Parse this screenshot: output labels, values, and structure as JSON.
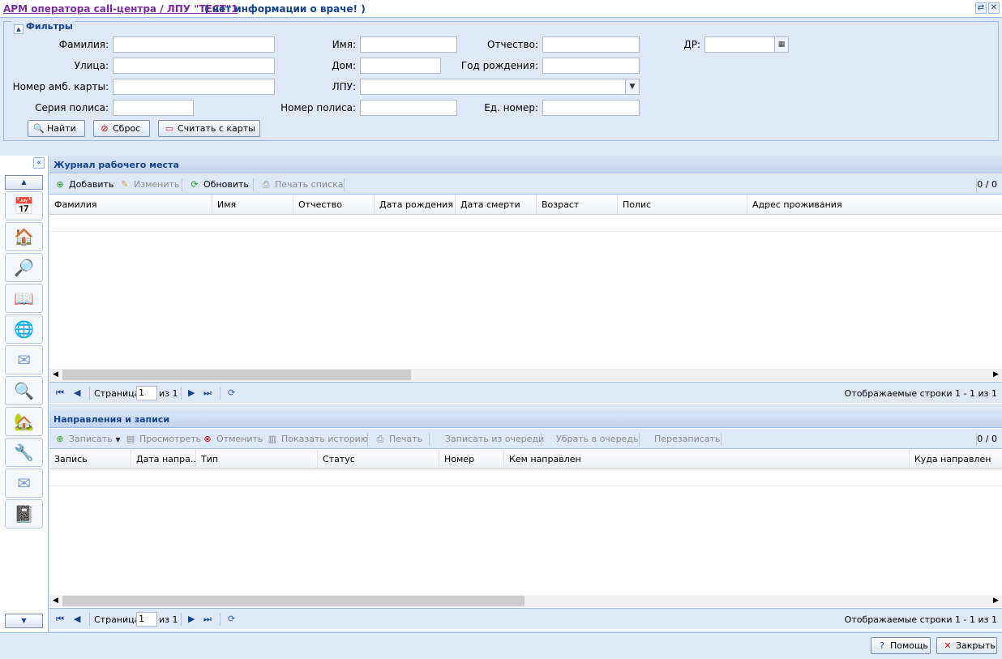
{
  "window": {
    "title": "АРМ оператора call-центра / ЛПУ \"ТЕСТ\"1",
    "subtitle": "( нет информации о враче! )"
  },
  "filters": {
    "legend": "Фильтры",
    "labels": {
      "surname": "Фамилия:",
      "name": "Имя:",
      "patronymic": "Отчество:",
      "dob": "ДР:",
      "street": "Улица:",
      "house": "Дом:",
      "birth_year": "Год рождения:",
      "card_number": "Номер амб. карты:",
      "lpu": "ЛПУ:",
      "policy_series": "Серия полиса:",
      "policy_number": "Номер полиса:",
      "unified_number": "Ед. номер:"
    },
    "buttons": {
      "find": "Найти",
      "reset": "Сброс",
      "read_card": "Считать с карты"
    }
  },
  "journal": {
    "title": "Журнал рабочего места",
    "toolbar": {
      "add": "Добавить",
      "edit": "Изменить",
      "refresh": "Обновить",
      "print_list": "Печать списка",
      "count": "0 / 0"
    },
    "columns": [
      "Фамилия",
      "Имя",
      "Отчество",
      "Дата рождения",
      "Дата смерти",
      "Возраст",
      "Полис",
      "Адрес проживания"
    ],
    "pager": {
      "page_label": "Страница",
      "page_value": "1",
      "of_label": "из 1",
      "displayed": "Отображаемые строки 1 - 1 из 1"
    }
  },
  "directions": {
    "title": "Направления и записи",
    "toolbar": {
      "record": "Записать",
      "view": "Просмотреть",
      "cancel": "Отменить",
      "show_history": "Показать историю",
      "print": "Печать",
      "record_from_queue": "Записать из очереди",
      "remove_to_queue": "Убрать в очередь",
      "rerecord": "Перезаписать",
      "count": "0 / 0"
    },
    "columns": [
      "Запись",
      "Дата напра...",
      "Тип",
      "Статус",
      "Номер",
      "Кем направлен",
      "Куда направлен"
    ],
    "pager": {
      "page_label": "Страница",
      "page_value": "1",
      "of_label": "из 1",
      "displayed": "Отображаемые строки 1 - 1 из 1"
    }
  },
  "footer": {
    "help": "Помощь",
    "close": "Закрыть"
  }
}
